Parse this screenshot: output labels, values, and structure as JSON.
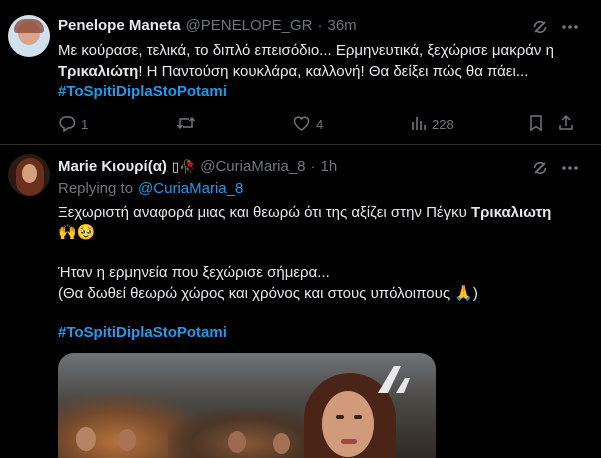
{
  "tweet1": {
    "author_name": "Penelope Maneta",
    "handle": "@PENELOPE_GR",
    "separator": "·",
    "time": "36m",
    "line1": "Με κούρασε, τελικά, το διπλό επεισόδιο... Ερμηνευτικά, ξεχώρισε μακράν η",
    "line2_bold": "Τρικαλιώτη",
    "line2_rest": "! Η Παντούση κουκλάρα, καλλονή! Θα δείξει πώς θα πάει...",
    "hashtag": "#ToSpitiDiplaStoPotami",
    "replies": "1",
    "likes": "4",
    "views": "228"
  },
  "tweet2": {
    "author_name": "Marie Κιουρί(α)",
    "name_emoji": "▯🥀",
    "handle": "@CuriaMaria_8",
    "separator": "·",
    "time": "1h",
    "replying_prefix": "Replying to",
    "replying_handle": "@CuriaMaria_8",
    "line1": "Ξεχωριστή αναφορά μιας και θεωρώ ότι της αξίζει στην Πέγκυ",
    "line1_bold": "Τρικαλιωτη",
    "line2": "🙌🥹",
    "line3": "Ήταν η ερμηνεία που ξεχώρισε σήμερα...",
    "line4": "(Θα δωθεί θεωρώ χώρος και χρόνος και στους υπόλοιπους 🙏)",
    "hashtag": "#ToSpitiDiplaStoPotami"
  },
  "colors": {
    "accent": "#1d9bf0",
    "muted": "#71767b",
    "divider": "#2f3336"
  },
  "icons": [
    "grok-icon",
    "more-icon",
    "reply-icon",
    "retweet-icon",
    "like-icon",
    "views-icon",
    "bookmark-icon",
    "share-icon",
    "channel-logo-icon"
  ]
}
